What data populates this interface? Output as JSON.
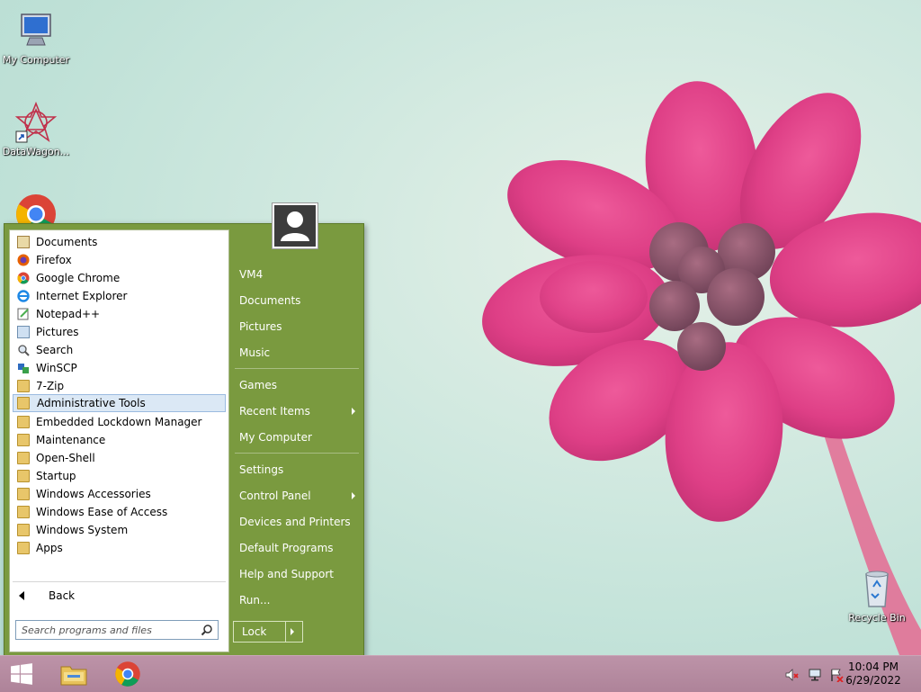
{
  "desktop": {
    "icons": [
      {
        "label": "My Computer",
        "icon": "computer-icon"
      },
      {
        "label": "DataWagon...",
        "icon": "datawagon-icon"
      },
      {
        "label": "",
        "icon": "chrome-icon"
      },
      {
        "label": "Recycle Bin",
        "icon": "recycle-bin-icon"
      }
    ]
  },
  "start_menu": {
    "programs": [
      {
        "label": "Documents",
        "icon": "documents-icon"
      },
      {
        "label": "Firefox",
        "icon": "firefox-icon"
      },
      {
        "label": "Google Chrome",
        "icon": "chrome-icon"
      },
      {
        "label": "Internet Explorer",
        "icon": "internet-explorer-icon"
      },
      {
        "label": "Notepad++",
        "icon": "notepad-plus-plus-icon"
      },
      {
        "label": "Pictures",
        "icon": "pictures-icon"
      },
      {
        "label": "Search",
        "icon": "search-icon"
      },
      {
        "label": "WinSCP",
        "icon": "winscp-icon"
      },
      {
        "label": "7-Zip",
        "icon": "folder-icon"
      },
      {
        "label": "Administrative Tools",
        "icon": "folder-icon",
        "highlighted": true
      },
      {
        "label": "Embedded Lockdown Manager",
        "icon": "folder-icon"
      },
      {
        "label": "Maintenance",
        "icon": "folder-icon"
      },
      {
        "label": "Open-Shell",
        "icon": "folder-icon"
      },
      {
        "label": "Startup",
        "icon": "folder-icon"
      },
      {
        "label": "Windows Accessories",
        "icon": "folder-icon"
      },
      {
        "label": "Windows Ease of Access",
        "icon": "folder-icon"
      },
      {
        "label": "Windows System",
        "icon": "folder-icon"
      },
      {
        "label": "Apps",
        "icon": "apps-icon"
      }
    ],
    "back_label": "Back",
    "search_placeholder": "Search programs and files",
    "right_items": [
      {
        "label": "VM4"
      },
      {
        "label": "Documents"
      },
      {
        "label": "Pictures"
      },
      {
        "label": "Music"
      },
      {
        "label": "Games"
      },
      {
        "label": "Recent Items",
        "submenu": true
      },
      {
        "label": "My Computer"
      },
      {
        "label": "Settings"
      },
      {
        "label": "Control Panel",
        "submenu": true
      },
      {
        "label": "Devices and Printers"
      },
      {
        "label": "Default Programs"
      },
      {
        "label": "Help and Support"
      },
      {
        "label": "Run..."
      }
    ],
    "lock_label": "Lock",
    "accent_color": "#7a9a3f"
  },
  "taskbar": {
    "pinned": [
      "windows-start-icon",
      "file-explorer-icon",
      "chrome-icon"
    ],
    "tray": {
      "time": "10:04 PM",
      "date": "6/29/2022",
      "icons": [
        "volume-muted-icon",
        "network-icon",
        "action-center-icon"
      ]
    },
    "color": "#b68aa0"
  }
}
